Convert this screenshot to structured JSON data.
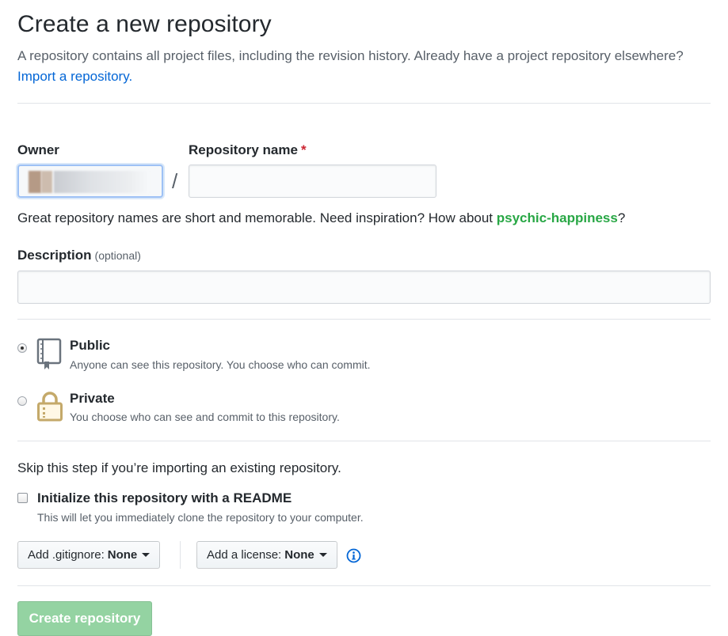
{
  "header": {
    "title": "Create a new repository",
    "subtitle": "A repository contains all project files, including the revision history. Already have a project repository elsewhere?",
    "import_link": "Import a repository."
  },
  "owner": {
    "label": "Owner"
  },
  "repo_name": {
    "label": "Repository name",
    "required_mark": "*",
    "value": "",
    "separator": "/"
  },
  "name_hint": {
    "text": "Great repository names are short and memorable. Need inspiration? How about ",
    "suggestion": "psychic-happiness",
    "end": "?"
  },
  "description": {
    "label": "Description",
    "optional": "(optional)",
    "value": ""
  },
  "visibility": {
    "selected": "public",
    "options": [
      {
        "id": "public",
        "title": "Public",
        "description": "Anyone can see this repository. You choose who can commit.",
        "icon": "repo-book-icon"
      },
      {
        "id": "private",
        "title": "Private",
        "description": "You choose who can see and commit to this repository.",
        "icon": "lock-icon"
      }
    ]
  },
  "init": {
    "skip_note": "Skip this step if you’re importing an existing repository.",
    "readme_label": "Initialize this repository with a README",
    "readme_desc": "This will let you immediately clone the repository to your computer.",
    "readme_checked": false
  },
  "gitignore": {
    "label": "Add .gitignore:",
    "value": "None"
  },
  "license": {
    "label": "Add a license:",
    "value": "None"
  },
  "info_icon": "info-icon",
  "submit": {
    "label": "Create repository"
  },
  "colors": {
    "link": "#0366d6",
    "suggestion": "#28a745",
    "required": "#cb2431",
    "create_button": "#94d3a2"
  }
}
